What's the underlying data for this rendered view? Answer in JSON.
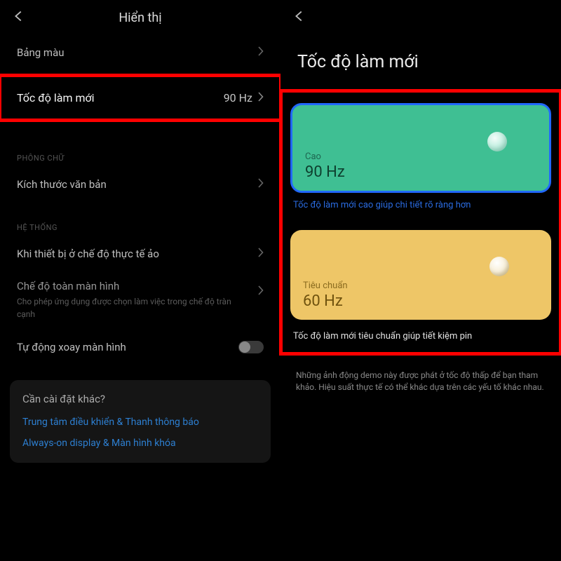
{
  "left": {
    "title": "Hiển thị",
    "rows": {
      "color_scheme": "Bảng màu",
      "refresh_rate": {
        "label": "Tốc độ làm mới",
        "value": "90 Hz"
      },
      "font_section": "PHÔNG CHỮ",
      "text_size": "Kích thước văn bản",
      "system_section": "HỆ THỐNG",
      "vr_mode": "Khi thiết bị ở chế độ thực tế ảo",
      "fullscreen": {
        "label": "Chế độ toàn màn hình",
        "sub": "Cho phép ứng dụng được chọn làm việc trong chế độ tràn cạnh"
      },
      "auto_rotate": "Tự động xoay màn hình"
    },
    "card": {
      "question": "Cần cài đặt khác?",
      "link1": "Trung tâm điều khiển & Thanh thông báo",
      "link2": "Always-on display & Màn hình khóa"
    }
  },
  "right": {
    "title": "Tốc độ làm mới",
    "high": {
      "label": "Cao",
      "value": "90 Hz"
    },
    "high_hint": "Tốc độ làm mới cao giúp chi tiết rõ ràng hơn",
    "standard": {
      "label": "Tiêu chuẩn",
      "value": "60 Hz"
    },
    "standard_hint": "Tốc độ làm mới tiêu chuẩn giúp tiết kiệm pin",
    "footnote": "Những ảnh động demo này được phát ở tốc độ thấp để bạn tham khảo. Hiệu suất thực tế có thể khác dựa trên các yếu tố khác nhau."
  }
}
